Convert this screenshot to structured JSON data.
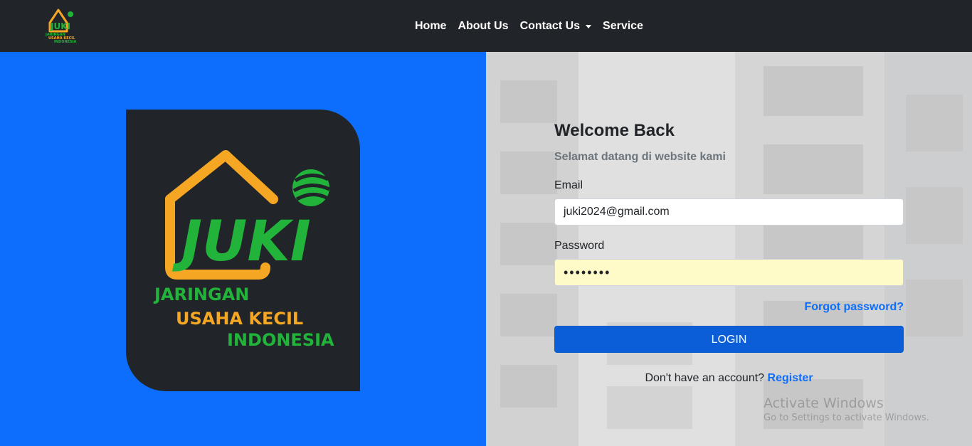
{
  "brand": {
    "logo_name": "juki-logo",
    "logo_word": "JUKI",
    "logo_line1": "JARINGAN",
    "logo_line2": "USAHA KECIL",
    "logo_line3": "INDONESIA"
  },
  "nav": {
    "items": [
      {
        "label": "Home"
      },
      {
        "label": "About Us"
      },
      {
        "label": "Contact Us"
      },
      {
        "label": "Service"
      }
    ]
  },
  "login": {
    "title": "Welcome Back",
    "subtitle": "Selamat datang di website kami",
    "email_label": "Email",
    "email_value": "juki2024@gmail.com",
    "password_label": "Password",
    "password_value": "••••••••",
    "forgot_label": "Forgot password?",
    "button_label": "LOGIN",
    "register_prompt": "Don't have an account?",
    "register_label": "Register"
  },
  "watermark": {
    "title": "Activate Windows",
    "subtitle": "Go to Settings to activate Windows."
  },
  "colors": {
    "navbar": "#212529",
    "primary": "#0d6efd",
    "logo_orange": "#f5a623",
    "logo_green": "#22b33a"
  }
}
